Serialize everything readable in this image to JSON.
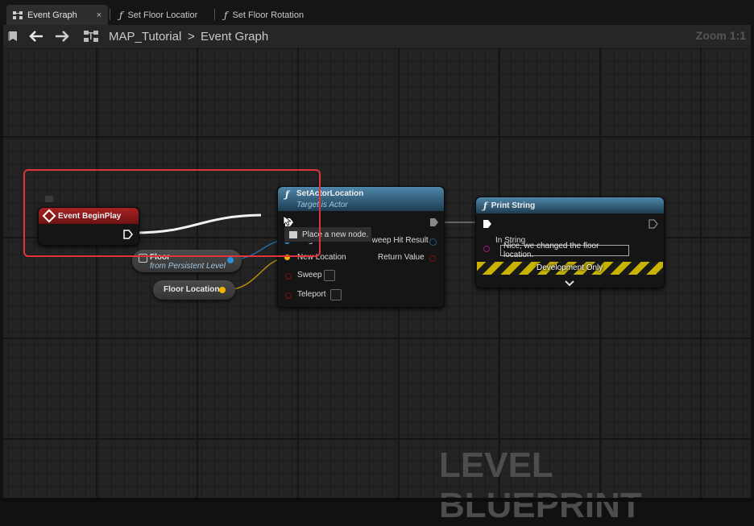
{
  "tabs": [
    {
      "label": "Event Graph",
      "close": "×"
    },
    {
      "label": "Set Floor Locatior"
    },
    {
      "label": "Set Floor Rotation"
    }
  ],
  "toolbar": {
    "breadcrumb_root": "MAP_Tutorial",
    "breadcrumb_separator": ">",
    "breadcrumb_current": "Event Graph",
    "zoom": "Zoom 1:1"
  },
  "nodes": {
    "begin_play": {
      "title": "Event BeginPlay",
      "color": "#8a1c1c"
    },
    "set_actor_location": {
      "title": "SetActorLocation",
      "subtitle": "Target is Actor",
      "pins_left": [
        "Target",
        "New Location",
        "Sweep",
        "Teleport"
      ],
      "pins_right": [
        "Sweep Hit Result",
        "Return Value"
      ],
      "color": "#3a6e8f"
    },
    "print_string": {
      "title": "Print String",
      "in_string_label": "In String",
      "in_string_value": "Nice, we changed the floor location.",
      "dev_only": "Development Only",
      "color": "#3a6e8f"
    },
    "floor_ref": {
      "title": "Floor",
      "subtitle": "from Persistent Level"
    },
    "floor_location": {
      "title": "Floor Location"
    }
  },
  "tooltip": {
    "text": "Place a new node."
  },
  "watermark": "LEVEL BLUEPRINT",
  "icons": [
    "blueprint-graph-icon",
    "function-icon",
    "bookmark-icon",
    "back-arrow-icon",
    "forward-arrow-icon",
    "graph-tree-icon",
    "event-diamond-icon",
    "exec-pin-icon",
    "cursor-icon",
    "chevron-down-icon"
  ],
  "colors": {
    "highlight": "#e0343b",
    "exec_wire": "#ffffff",
    "vector_pin": "#f0b400",
    "object_pin": "#2a8fd6"
  }
}
